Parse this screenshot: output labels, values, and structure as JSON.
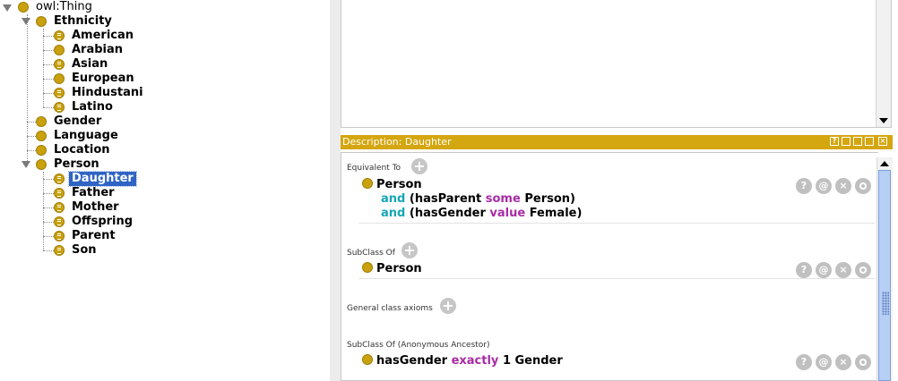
{
  "tree": {
    "root": "owl:Thing",
    "ethnicity": "Ethnicity",
    "american": "American",
    "arabian": "Arabian",
    "asian": "Asian",
    "european": "European",
    "hindustani": "Hindustani",
    "latino": "Latino",
    "gender": "Gender",
    "language": "Language",
    "location": "Location",
    "person": "Person",
    "daughter": "Daughter",
    "father": "Father",
    "mother": "Mother",
    "offspring": "Offspring",
    "parent": "Parent",
    "son": "Son",
    "selected": "Daughter"
  },
  "description": {
    "header": "Description: Daughter",
    "sections": {
      "equivalent_to": "Equivalent To",
      "subclass_of": "SubClass Of",
      "general_axioms": "General class axioms",
      "anon_ancestor": "SubClass Of (Anonymous Ancestor)"
    },
    "equivalent": {
      "class": "Person",
      "line2_kw": "and",
      "line2_a": "(hasParent",
      "line2_some": "some",
      "line2_b": "Person)",
      "line3_kw": "and",
      "line3_a": "(hasGender",
      "line3_value": "value",
      "line3_b": "Female)"
    },
    "subclass": {
      "class": "Person"
    },
    "ancestor": {
      "prop": "hasGender",
      "kw": "exactly",
      "rest": "1 Gender"
    },
    "buttons": {
      "help": "?",
      "annotate": "@",
      "delete": "×"
    }
  },
  "colors": {
    "class_dot": "#c9a10e",
    "header_bar": "#d4a60f",
    "selection": "#2f64c5",
    "keyword_and": "#15a6b5",
    "keyword_restriction": "#a82ba6"
  },
  "icons": {
    "class": "class-circle-icon",
    "defined_class": "defined-class-icon",
    "add": "plus-circle-icon",
    "help": "help-icon",
    "annotate": "at-icon",
    "delete": "close-icon",
    "edit": "ring-icon"
  }
}
